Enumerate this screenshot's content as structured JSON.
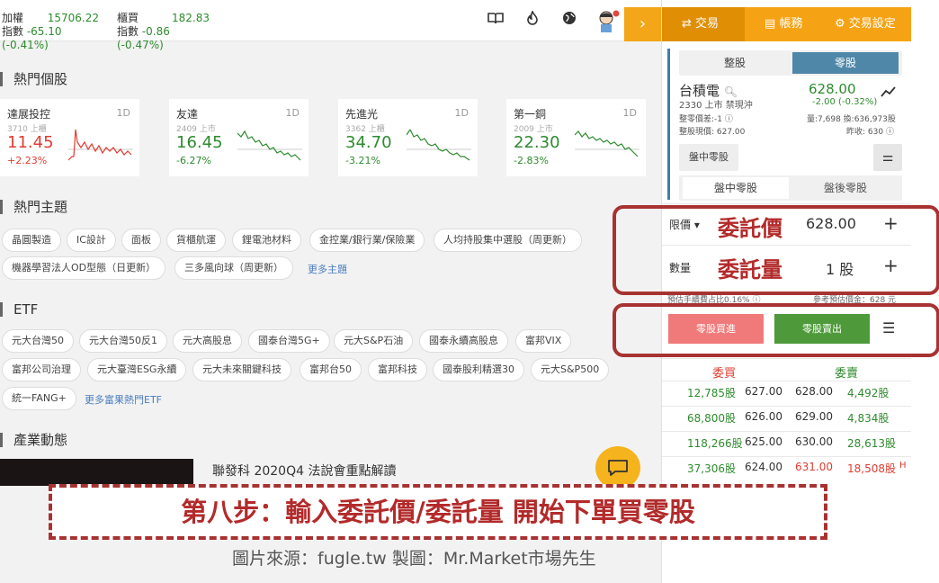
{
  "indices": [
    {
      "name1": "加權",
      "name2": "指數",
      "value": "15706.22",
      "change": "-65.10 (-0.41%)"
    },
    {
      "name1": "櫃買",
      "name2": "指數",
      "value": "182.83",
      "change": "-0.86 (-0.47%)"
    }
  ],
  "top_icons": [
    "book-icon",
    "fire-icon",
    "globe-icon",
    "avatar-icon"
  ],
  "expand_label": "›",
  "hot_stocks": {
    "title": "熱門個股",
    "cards": [
      {
        "name": "達展投控",
        "code": "3710 上櫃",
        "period": "1D",
        "price": "11.45",
        "change": "+2.23%",
        "trend": "up"
      },
      {
        "name": "友達",
        "code": "2409 上市",
        "period": "1D",
        "price": "16.45",
        "change": "-6.27%",
        "trend": "down"
      },
      {
        "name": "先進光",
        "code": "3362 上櫃",
        "period": "1D",
        "price": "34.70",
        "change": "-3.21%",
        "trend": "down"
      },
      {
        "name": "第一銅",
        "code": "2009 上市",
        "period": "1D",
        "price": "22.30",
        "change": "-2.83%",
        "trend": "down"
      }
    ]
  },
  "hot_topics": {
    "title": "熱門主題",
    "tags": [
      "晶圓製造",
      "IC設計",
      "面板",
      "貨櫃航運",
      "鋰電池材料",
      "金控業/銀行業/保險業",
      "人均持股集中選股（周更新）",
      "機器學習法人OD型態（日更新）",
      "三多風向球（周更新）"
    ],
    "more": "更多主題"
  },
  "etf": {
    "title": "ETF",
    "tags": [
      "元大台灣50",
      "元大台灣50反1",
      "元大高股息",
      "國泰台灣5G+",
      "元大S&P石油",
      "國泰永續高股息",
      "富邦VIX",
      "富邦公司治理",
      "元大臺灣ESG永續",
      "元大未來關鍵科技",
      "富邦台50",
      "富邦科技",
      "國泰股利精選30",
      "元大S&P500",
      "統一FANG+"
    ],
    "more": "更多富果熱門ETF"
  },
  "industry": {
    "title": "產業動態",
    "news_title": "聯發科 2020Q4 法說會重點解讀"
  },
  "panel": {
    "tabs": [
      "交易",
      "帳務",
      "交易設定"
    ],
    "lot_toggle": [
      "整股",
      "零股"
    ],
    "stock_name": "台積電",
    "stock_code": "2330 上市 禁現沖",
    "price": "628.00",
    "price_change": "-2.00 (-0.32%)",
    "line1_left": "整零價差:-1",
    "line1_right": "量:7,698  換:636,973股",
    "line2_left": "整股現價: 627.00",
    "line2_right": "昨收: 630",
    "intraday_btn": "盤中零股",
    "session_toggle": [
      "盤中零股",
      "盤後零股"
    ],
    "order_type": "限價",
    "price_label": "委託價",
    "order_price": "628.00",
    "qty_label_small": "數量",
    "qty_label": "委託量",
    "qty_value": "1 股",
    "plus": "+",
    "fee_left": "預估手續費占比0.16% ⓘ",
    "fee_right": "參考預估價金：628 元",
    "buy_label": "零股買進",
    "sell_label": "零股賣出",
    "orderbook_headers": [
      "委買",
      "委賣"
    ],
    "orderbook": [
      {
        "bid_qty": "12,785股",
        "bid": "627.00",
        "ask": "628.00",
        "ask_qty": "4,492股",
        "flag": ""
      },
      {
        "bid_qty": "68,800股",
        "bid": "626.00",
        "ask": "629.00",
        "ask_qty": "4,834股",
        "flag": ""
      },
      {
        "bid_qty": "118,266股",
        "bid": "625.00",
        "ask": "630.00",
        "ask_qty": "28,613股",
        "flag": ""
      },
      {
        "bid_qty": "37,306股",
        "bid": "624.00",
        "ask": "631.00",
        "ask_qty": "18,508股",
        "flag": "H"
      }
    ]
  },
  "annotation": {
    "banner": "第八步：輸入委託價/委託量 開始下單買零股",
    "credit": "圖片來源：fugle.tw  製圖：Mr.Market市場先生"
  },
  "colors": {
    "accent": "#f5a315",
    "up": "#e03c31",
    "down": "#2e8b2e",
    "annotation": "#a83232"
  }
}
